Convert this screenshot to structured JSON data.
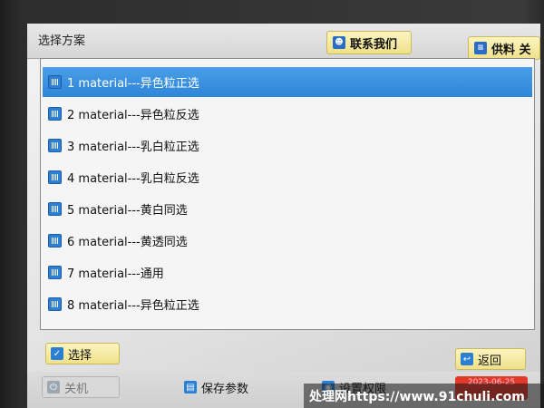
{
  "window": {
    "title": "选择方案"
  },
  "top_buttons": {
    "contact": {
      "label": "联系我们",
      "icon": "person-icon"
    },
    "feed": {
      "label": "供料 关",
      "icon": "feed-icon"
    }
  },
  "list": {
    "items": [
      {
        "label": "1 material---异色粒正选",
        "selected": true
      },
      {
        "label": "2 material---异色粒反选",
        "selected": false
      },
      {
        "label": "3 material---乳白粒正选",
        "selected": false
      },
      {
        "label": "4 material---乳白粒反选",
        "selected": false
      },
      {
        "label": "5 material---黄白同选",
        "selected": false
      },
      {
        "label": "6 material---黄透同选",
        "selected": false
      },
      {
        "label": "7 material---通用",
        "selected": false
      },
      {
        "label": "8 material---异色粒正选",
        "selected": false
      }
    ]
  },
  "actions": {
    "select_label": "选择",
    "back_label": "返回"
  },
  "footer": {
    "shutdown_label": "关机",
    "save_label": "保存参数",
    "third_label": "设置权限",
    "date": "2023-06-25"
  },
  "watermark": {
    "text": "处理网https://www.91chuli.com"
  },
  "colors": {
    "selection": "#2f86d8",
    "button_yellow": "#efe18a",
    "date_red": "#e23a2a"
  }
}
